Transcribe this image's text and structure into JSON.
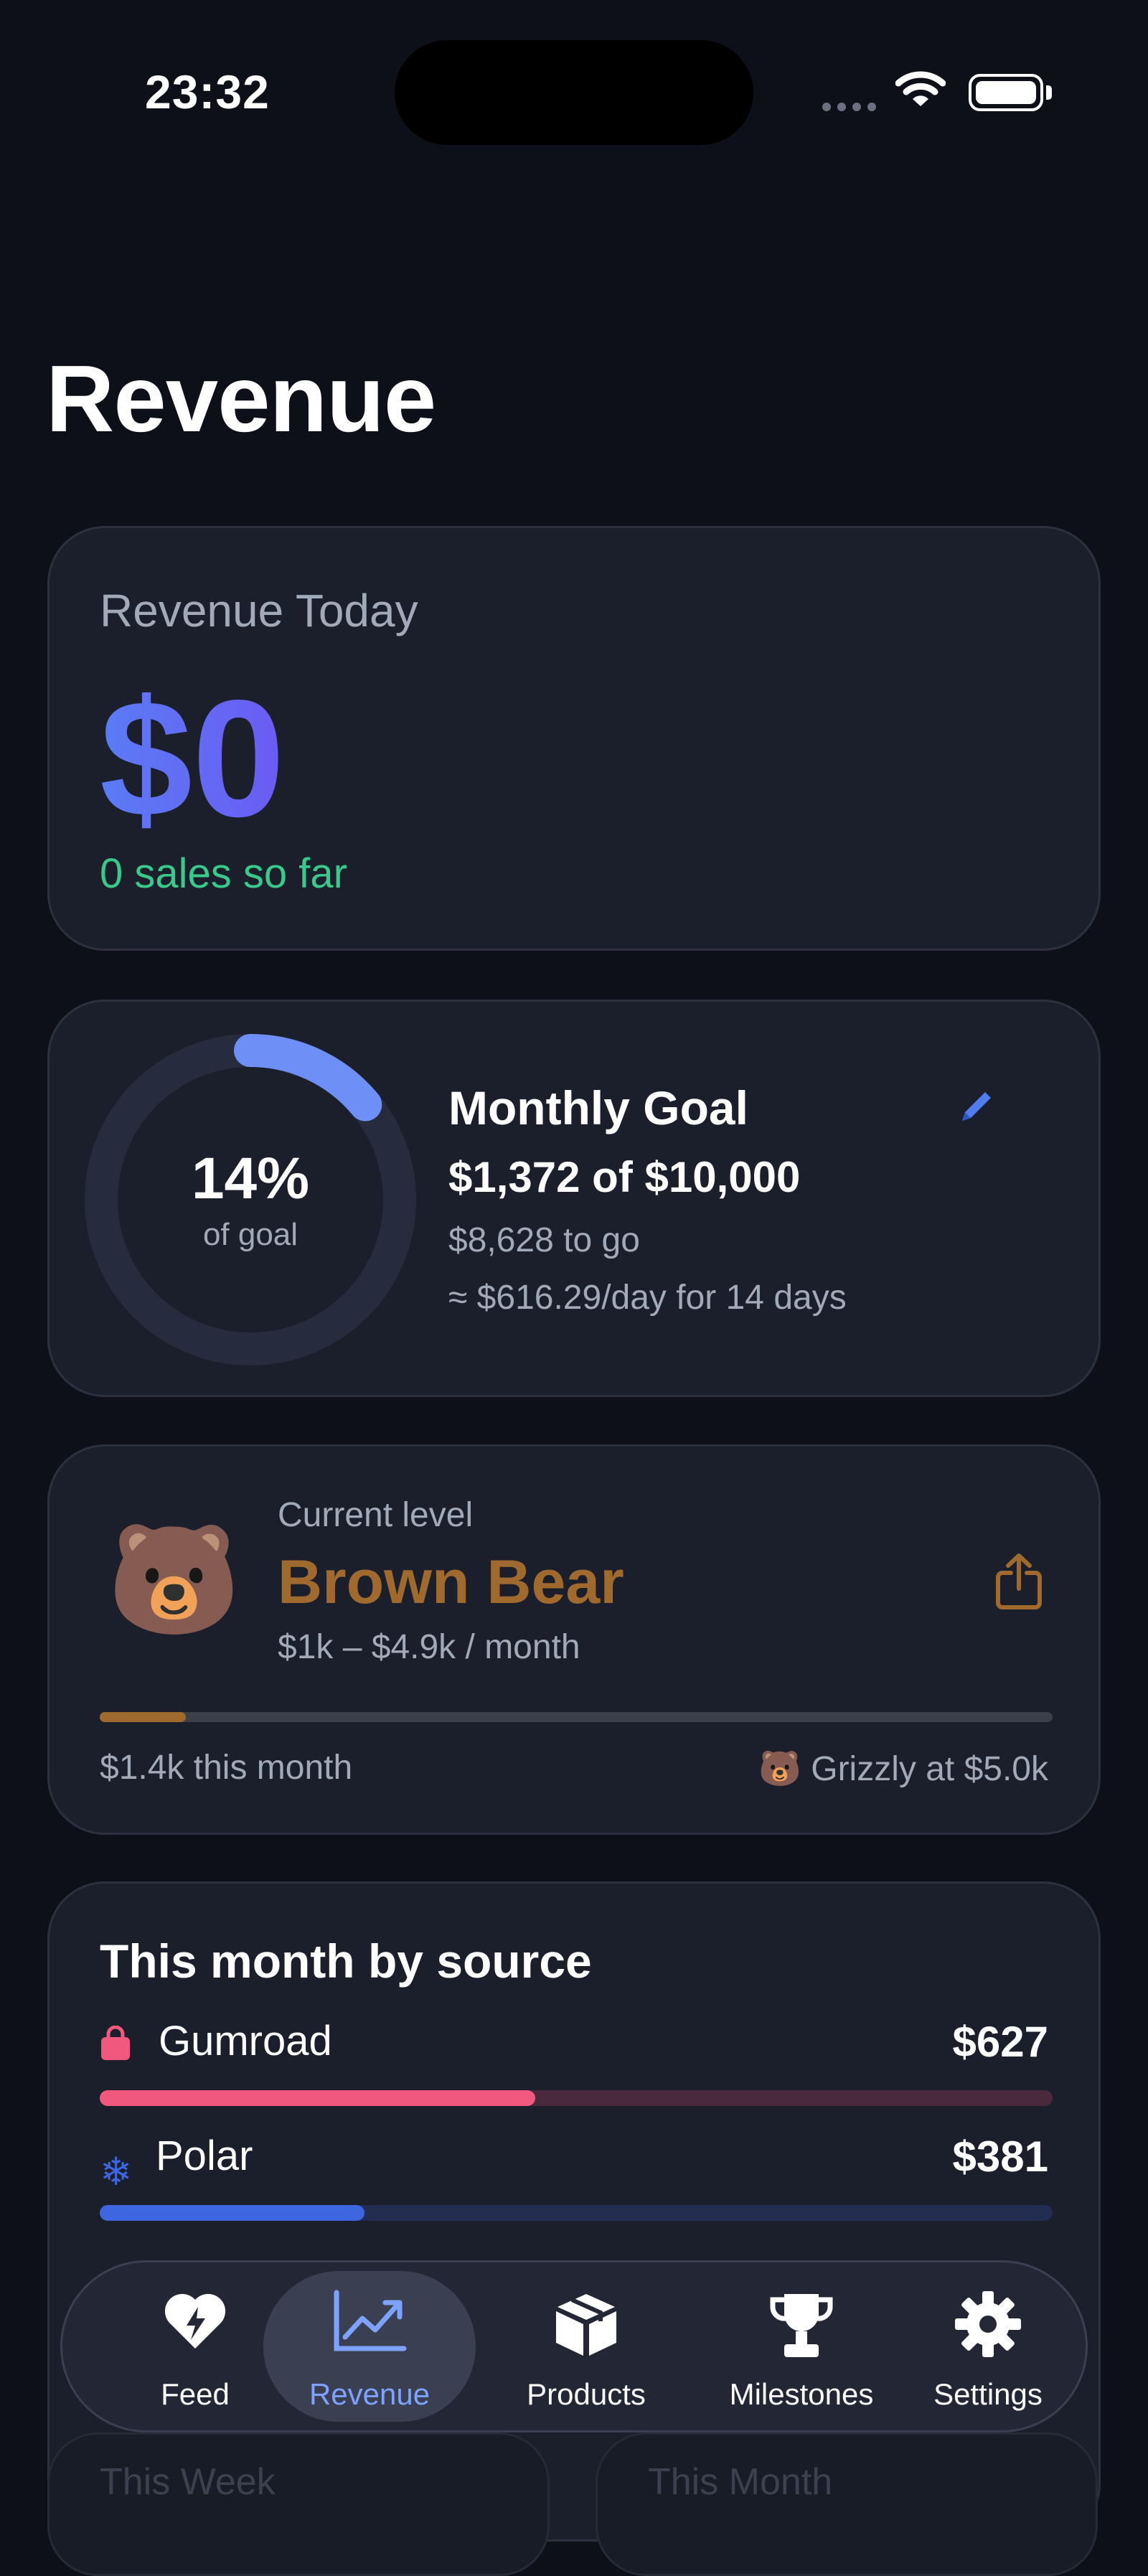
{
  "status_bar": {
    "time": "23:32"
  },
  "page": {
    "title": "Revenue"
  },
  "revenue_today": {
    "label": "Revenue Today",
    "value": "$0",
    "sales": "0 sales so far"
  },
  "monthly_goal": {
    "percent_text": "14%",
    "percent_value": 0.14,
    "percent_sub": "of goal",
    "title": "Monthly Goal",
    "amount": "$1,372 of $10,000",
    "to_go": "$8,628 to go",
    "per_day": "≈ $616.29/day for 14 days"
  },
  "level": {
    "emoji": "🐻",
    "current_label": "Current level",
    "name": "Brown Bear",
    "range": "$1k – $4.9k / month",
    "progress": 0.09,
    "this_month": "$1.4k this month",
    "next": "🐻 Grizzly at $5.0k",
    "color": "#a0692d"
  },
  "sources": {
    "title": "This month by source",
    "items": [
      {
        "name": "Gumroad",
        "amount": "$627",
        "fraction": 0.457,
        "color": "#f0587e",
        "track": "#4a2a3a",
        "icon": "shopping-bag-icon"
      },
      {
        "name": "Polar",
        "amount": "$381",
        "fraction": 0.278,
        "color": "#3d66e0",
        "track": "#232d52",
        "icon": "snowflake-icon"
      }
    ]
  },
  "bottom_cards": {
    "left": "This Week",
    "right": "This Month"
  },
  "tabs": [
    {
      "label": "Feed",
      "icon": "heart-bolt-icon",
      "active": false
    },
    {
      "label": "Revenue",
      "icon": "chart-up-icon",
      "active": true
    },
    {
      "label": "Products",
      "icon": "box-icon",
      "active": false
    },
    {
      "label": "Milestones",
      "icon": "trophy-icon",
      "active": false
    },
    {
      "label": "Settings",
      "icon": "gear-icon",
      "active": false
    }
  ],
  "colors": {
    "accent": "#7da2ff",
    "success": "#39c98a",
    "ring_track": "#262c3e",
    "ring_fill": "#6e8ff5"
  }
}
